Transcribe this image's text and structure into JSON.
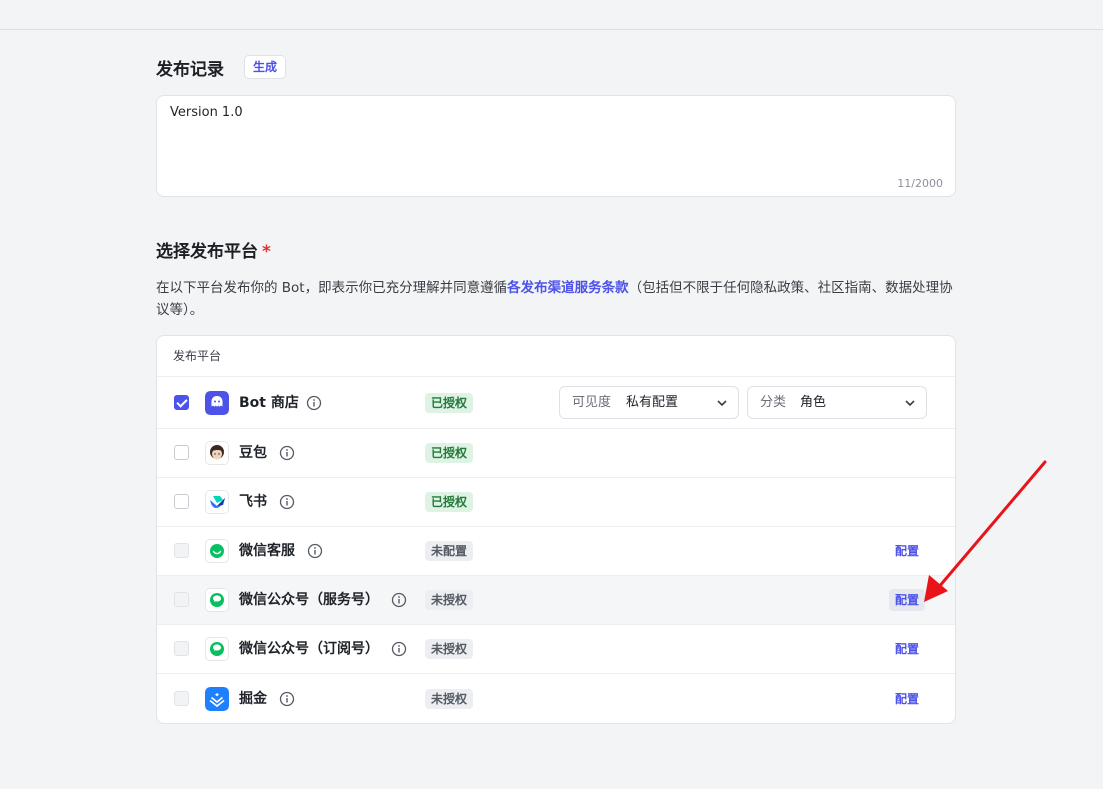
{
  "release_notes": {
    "title": "发布记录",
    "generate_label": "生成",
    "value": "Version 1.0",
    "char_count": "11/2000"
  },
  "platform_select": {
    "title": "选择发布平台",
    "required_mark": "*",
    "desc_before": "在以下平台发布你的 Bot，即表示你已充分理解并同意遵循",
    "desc_link": "各发布渠道服务条款",
    "desc_after": "（包括但不限于任何隐私政策、社区指南、数据处理协议等）。"
  },
  "table": {
    "header": "发布平台",
    "rows": [
      {
        "name": "Bot 商店",
        "status": "已授权",
        "checked": true
      },
      {
        "name": "豆包",
        "status": "已授权",
        "checked": false
      },
      {
        "name": "飞书",
        "status": "已授权",
        "checked": false
      },
      {
        "name": "微信客服",
        "status": "未配置",
        "config": "配置"
      },
      {
        "name": "微信公众号（服务号）",
        "status": "未授权",
        "config": "配置"
      },
      {
        "name": "微信公众号（订阅号）",
        "status": "未授权",
        "config": "配置"
      },
      {
        "name": "掘金",
        "status": "未授权",
        "config": "配置"
      }
    ]
  },
  "bot_store_options": {
    "visibility_label": "可见度",
    "visibility_value": "私有配置",
    "category_label": "分类",
    "category_value": "角色"
  },
  "colors": {
    "accent": "#4d53e8",
    "authorized_bg": "#dff3e4",
    "authorized_text": "#237a3b",
    "annotation_arrow": "#e8141a"
  }
}
